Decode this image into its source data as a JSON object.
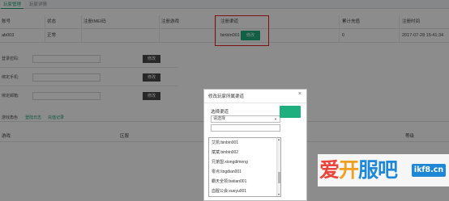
{
  "tabs": [
    "玩家管理",
    "玩家详情"
  ],
  "table": {
    "headers": [
      "账号",
      "状态",
      "注册IMEI码",
      "注册游戏",
      "注册渠道",
      "累计充值",
      "注册时间"
    ],
    "row": {
      "account": "ab003",
      "status": "正常",
      "imei": "",
      "game": "",
      "channel": "binbin001",
      "recharge": "0",
      "reg_time": "2017-07-28 15:41:34",
      "modify_btn": "修改"
    }
  },
  "form": {
    "rows": [
      {
        "label": "登录密码:",
        "button": "修改"
      },
      {
        "label": "绑定手机:",
        "button": "修改"
      },
      {
        "label": "绑定邮箱:",
        "button": "修改"
      }
    ]
  },
  "subtabs": [
    "游戏角色",
    "登陆日志",
    "充值记录"
  ],
  "subheaders": [
    "游戏",
    "区服",
    "等级"
  ],
  "modal": {
    "title": "修改玩家所属渠道",
    "close_icon": "×",
    "label": "选择渠道",
    "select_value": "请选择",
    "options": [
      "艾凯:binbin001",
      "斌斌:binbin002",
      "兄弟盟:xiongdimeng",
      "零点:lingdian001",
      "霸天全领:batian001",
      "血腥公会:xueyu001"
    ]
  },
  "watermark": {
    "text": "爱开服吧",
    "url": "ikf8.cn",
    "colors": [
      "#e8453c",
      "#f0a020",
      "#1e88d6",
      "#1e88d6"
    ]
  },
  "colors": {
    "accent": "#1fae7d",
    "highlight": "#e02020"
  }
}
